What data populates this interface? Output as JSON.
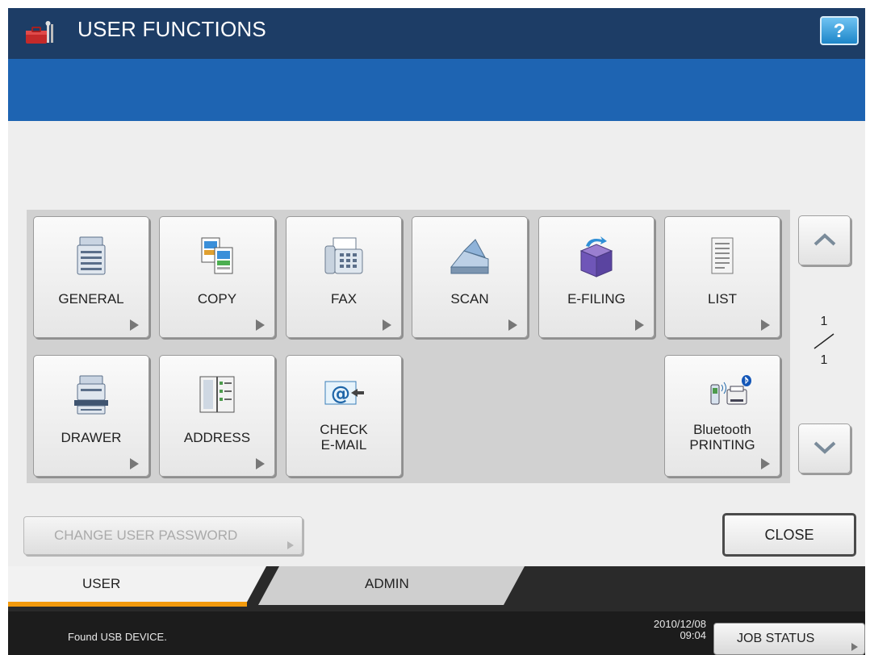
{
  "header": {
    "title": "USER FUNCTIONS",
    "help_label": "?"
  },
  "functions": [
    {
      "label": "GENERAL",
      "icon": "mfp-icon"
    },
    {
      "label": "COPY",
      "icon": "copy-documents-icon"
    },
    {
      "label": "FAX",
      "icon": "fax-icon"
    },
    {
      "label": "SCAN",
      "icon": "scanner-icon"
    },
    {
      "label": "E-FILING",
      "icon": "efiling-box-icon"
    },
    {
      "label": "LIST",
      "icon": "list-document-icon"
    },
    {
      "label": "DRAWER",
      "icon": "drawer-printer-icon"
    },
    {
      "label": "ADDRESS",
      "icon": "address-book-icon"
    },
    {
      "label": "CHECK\nE-MAIL",
      "icon": "email-icon"
    },
    {
      "label": "Bluetooth\nPRINTING",
      "icon": "bluetooth-printing-icon"
    }
  ],
  "pager": {
    "current": "1",
    "total": "1"
  },
  "buttons": {
    "change_password": "CHANGE USER PASSWORD",
    "close": "CLOSE",
    "job_status": "JOB STATUS"
  },
  "tabs": [
    {
      "label": "USER",
      "active": true
    },
    {
      "label": "ADMIN",
      "active": false
    }
  ],
  "status": {
    "message": "Found USB DEVICE.",
    "date": "2010/12/08",
    "time": "09:04"
  },
  "colors": {
    "header": "#1d3d66",
    "subbar": "#1e64b2",
    "active_tab_accent": "#f39a0d",
    "help": "#1d86c9"
  }
}
